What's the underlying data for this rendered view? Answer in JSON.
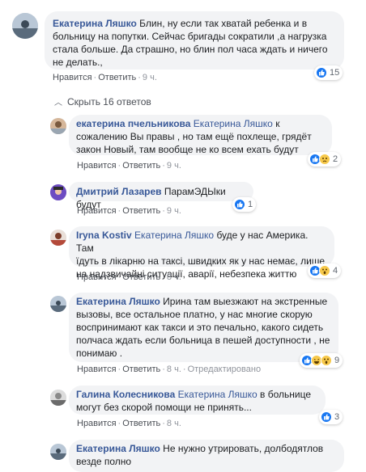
{
  "actions": {
    "like": "Нравится",
    "reply": "Ответить",
    "sep": "·",
    "edited": "Отредактировано"
  },
  "hide_replies": "Скрыть 16 ответов",
  "comments": [
    {
      "author": "Екатерина Ляшко",
      "mention": "",
      "lines": [
        "Блин, ну если так хватай ребенка и в",
        "больницу на попутки. Сейчас бригады сократили ,а нагрузка",
        "стала больше. Да страшно, но блин пол часа ждать и ничего",
        "не делать.,"
      ],
      "time": "9 ч.",
      "reactions": {
        "types": [
          "like"
        ],
        "count": "15"
      }
    },
    {
      "author": "екатерина пчельникова",
      "mention": "Екатерина Ляшко",
      "lines": [
        "к",
        "сожалению Вы правы , но там ещё похлеще, грядёт",
        "закон Новый, там вообще не ко всем ехать будут"
      ],
      "time": "9 ч.",
      "reactions": {
        "types": [
          "like",
          "sad"
        ],
        "count": "2"
      }
    },
    {
      "author": "Дмитрий Лазарев",
      "mention": "",
      "lines": [
        "ПарамЭДЫки будут"
      ],
      "time": "9 ч.",
      "reactions": {
        "types": [
          "like"
        ],
        "count": "1"
      }
    },
    {
      "author": "Iryna Kostiv",
      "mention": "Екатерина Ляшко",
      "lines": [
        "буде у нас Америка. Там",
        "їдуть в лікарню на таксі, швидких як у нас немає, лише",
        "на надзвичайні ситуації, аварії, небезпека життю"
      ],
      "time": "8 ч.",
      "reactions": {
        "types": [
          "like",
          "wow"
        ],
        "count": "4"
      }
    },
    {
      "author": "Екатерина Ляшко",
      "mention": "",
      "lines": [
        "Ирина там выезжают на экстренные",
        "вызовы, все остальное платно, у нас многие скорую",
        "воспринимают как такси и это печально, какого сидеть",
        "полчаса ждать если больница в пешей доступности , не",
        "понимаю ."
      ],
      "time": "8 ч.",
      "edited": true,
      "reactions": {
        "types": [
          "like",
          "haha",
          "wow"
        ],
        "count": "9"
      }
    },
    {
      "author": "Галина Колесникова",
      "mention": "Екатерина Ляшко",
      "lines": [
        "в больнице",
        "могут без скорой помощи не принять..."
      ],
      "time": "8 ч.",
      "reactions": {
        "types": [
          "like"
        ],
        "count": "3"
      }
    },
    {
      "author": "Екатерина Ляшко",
      "mention": "",
      "lines": [
        "Не нужно утрировать, долбодятлов",
        "везде полно"
      ],
      "time": "",
      "reactions": {
        "types": [],
        "count": ""
      }
    }
  ]
}
